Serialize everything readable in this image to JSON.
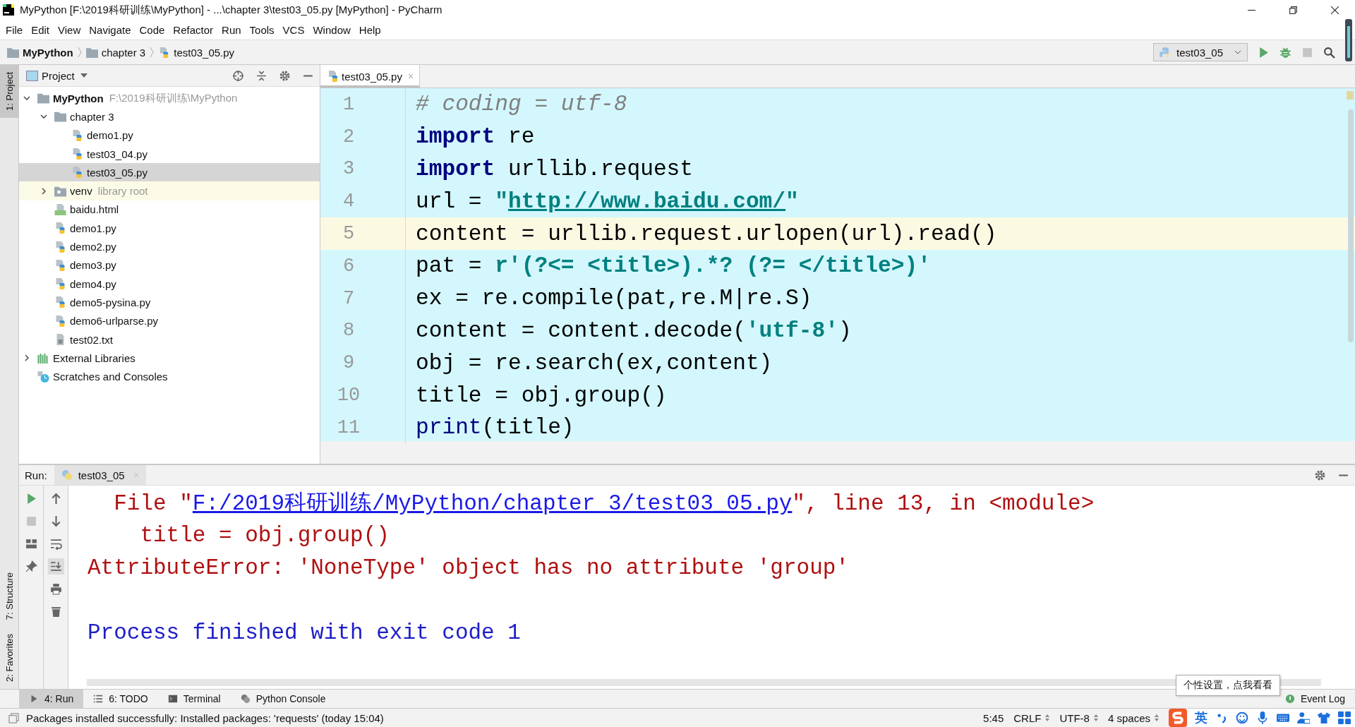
{
  "window": {
    "title": "MyPython [F:\\2019科研训练\\MyPython] - ...\\chapter 3\\test03_05.py [MyPython] - PyCharm"
  },
  "menu": [
    "File",
    "Edit",
    "View",
    "Navigate",
    "Code",
    "Refactor",
    "Run",
    "Tools",
    "VCS",
    "Window",
    "Help"
  ],
  "breadcrumbs": [
    {
      "label": "MyPython",
      "kind": "project"
    },
    {
      "label": "chapter 3",
      "kind": "folder"
    },
    {
      "label": "test03_05.py",
      "kind": "file"
    }
  ],
  "run_config": {
    "label": "test03_05"
  },
  "side_stripe": {
    "top": [
      "1: Project"
    ],
    "bottom": [
      "7: Structure",
      "2: Favorites"
    ]
  },
  "project_panel": {
    "title": "Project",
    "tree": [
      {
        "name": "MyPython",
        "note": "F:\\2019科研训练\\MyPython",
        "kind": "folder",
        "bold": true,
        "expanded": true,
        "selected": false,
        "children": [
          {
            "name": "chapter 3",
            "kind": "folder",
            "expanded": true,
            "selected": false,
            "children": [
              {
                "name": "demo1.py",
                "kind": "py",
                "selected": false
              },
              {
                "name": "test03_04.py",
                "kind": "py",
                "selected": false
              },
              {
                "name": "test03_05.py",
                "kind": "py",
                "selected": true
              }
            ]
          },
          {
            "name": "venv",
            "note": "library root",
            "kind": "library",
            "expanded": false,
            "selected": false
          },
          {
            "name": "baidu.html",
            "kind": "html",
            "selected": false
          },
          {
            "name": "demo1.py",
            "kind": "py",
            "selected": false
          },
          {
            "name": "demo2.py",
            "kind": "py",
            "selected": false
          },
          {
            "name": "demo3.py",
            "kind": "py",
            "selected": false
          },
          {
            "name": "demo4.py",
            "kind": "py",
            "selected": false
          },
          {
            "name": "demo5-pysina.py",
            "kind": "py",
            "selected": false
          },
          {
            "name": "demo6-urlparse.py",
            "kind": "py",
            "selected": false
          },
          {
            "name": "test02.txt",
            "kind": "txt",
            "selected": false
          }
        ]
      },
      {
        "name": "External Libraries",
        "kind": "libs",
        "expanded": false,
        "selected": false
      },
      {
        "name": "Scratches and Consoles",
        "kind": "scratch",
        "selected": false
      }
    ]
  },
  "editor": {
    "tab": {
      "label": "test03_05.py",
      "selected": true
    },
    "lines": [
      {
        "n": "1",
        "current": false,
        "tokens": [
          {
            "t": "# coding = utf-8",
            "kind": "comment"
          }
        ]
      },
      {
        "n": "2",
        "current": false,
        "tokens": [
          {
            "t": "import",
            "kind": "kw"
          },
          {
            "t": " re",
            "kind": "plain"
          }
        ]
      },
      {
        "n": "3",
        "current": false,
        "tokens": [
          {
            "t": "import",
            "kind": "kw"
          },
          {
            "t": " urllib.request",
            "kind": "plain"
          }
        ]
      },
      {
        "n": "4",
        "current": false,
        "tokens": [
          {
            "t": "url = ",
            "kind": "plain"
          },
          {
            "t": "\"",
            "kind": "str"
          },
          {
            "t": "http://www.baidu.com/",
            "kind": "link"
          },
          {
            "t": "\"",
            "kind": "str"
          }
        ]
      },
      {
        "n": "5",
        "current": true,
        "tokens": [
          {
            "t": "content = urllib.request.urlopen(url).read()",
            "kind": "plain"
          }
        ]
      },
      {
        "n": "6",
        "current": false,
        "tokens": [
          {
            "t": "pat = ",
            "kind": "plain"
          },
          {
            "t": "r'(?<= <title>).*? (?= </title>)'",
            "kind": "str"
          }
        ]
      },
      {
        "n": "7",
        "current": false,
        "tokens": [
          {
            "t": "ex = re.compile(pat,re.M|re.S)",
            "kind": "plain"
          }
        ]
      },
      {
        "n": "8",
        "current": false,
        "tokens": [
          {
            "t": "content = content.decode(",
            "kind": "plain"
          },
          {
            "t": "'utf-8'",
            "kind": "str"
          },
          {
            "t": ")",
            "kind": "plain"
          }
        ]
      },
      {
        "n": "9",
        "current": false,
        "tokens": [
          {
            "t": "obj = re.search(ex,content)",
            "kind": "plain"
          }
        ]
      },
      {
        "n": "10",
        "current": false,
        "tokens": [
          {
            "t": "title = obj.group()",
            "kind": "plain"
          }
        ]
      },
      {
        "n": "11",
        "current": false,
        "tokens": [
          {
            "t": "print",
            "kind": "builtin"
          },
          {
            "t": "(title)",
            "kind": "plain"
          }
        ]
      }
    ]
  },
  "run_panel": {
    "label": "Run:",
    "tab": "test03_05",
    "output": [
      {
        "kind": "error",
        "tokens": [
          {
            "t": "  File \"",
            "kind": "plain"
          },
          {
            "t": "F:/2019科研训练/MyPython/chapter 3/test03_05.py",
            "kind": "link"
          },
          {
            "t": "\", line 13, in <module>",
            "kind": "plain"
          }
        ]
      },
      {
        "kind": "error",
        "tokens": [
          {
            "t": "    title = obj.group()",
            "kind": "plain"
          }
        ]
      },
      {
        "kind": "error",
        "tokens": [
          {
            "t": "AttributeError: 'NoneType' object has no attribute 'group'",
            "kind": "plain"
          }
        ]
      },
      {
        "kind": "blank"
      },
      {
        "kind": "info",
        "tokens": [
          {
            "t": "Process finished with exit code 1",
            "kind": "plain"
          }
        ]
      }
    ]
  },
  "tool_tabs": [
    {
      "label": "4: Run",
      "kind": "run",
      "selected": true
    },
    {
      "label": "6: TODO",
      "kind": "list",
      "selected": false
    },
    {
      "label": "Terminal",
      "kind": "terminal",
      "selected": false
    },
    {
      "label": "Python Console",
      "kind": "python",
      "selected": false
    }
  ],
  "event_log": "Event Log",
  "status_bar": {
    "message": "Packages installed successfully: Installed packages: 'requests' (today 15:04)",
    "items": [
      {
        "text": "5:45",
        "dropdown": false
      },
      {
        "text": "CRLF",
        "dropdown": true
      },
      {
        "text": "UTF-8",
        "dropdown": true
      },
      {
        "text": "4 spaces",
        "dropdown": true
      }
    ],
    "ime_label": "英"
  },
  "tooltip": "个性设置，点我看看"
}
